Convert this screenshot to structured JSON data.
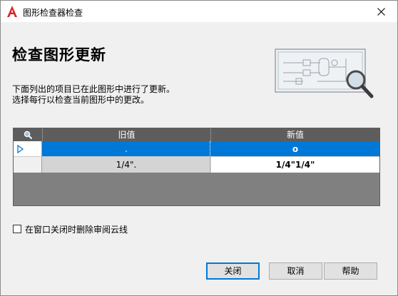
{
  "window": {
    "title": "图形检查器检查",
    "app_icon": "autocad-a-icon",
    "close_icon": "close-icon"
  },
  "heading": "检查图形更新",
  "description": {
    "line1": "下面列出的项目已在此图形中进行了更新。",
    "line2": "选择每行以检查当前图形中的更改。"
  },
  "grid": {
    "corner_icon": "magnifier-icon",
    "columns": [
      "旧值",
      "新值"
    ],
    "rows": [
      {
        "indicator": "triangle-right-icon",
        "old": ".",
        "new": "o",
        "selected": true
      },
      {
        "indicator": "",
        "old": "1/4\".",
        "new": "1/4\"1/4\"",
        "selected": false
      }
    ]
  },
  "checkbox": {
    "label": "在窗口关闭时删除审阅云线",
    "checked": false
  },
  "buttons": {
    "close": "关闭",
    "cancel": "取消",
    "help": "帮助"
  },
  "colors": {
    "selection": "#0078d7",
    "header_bg": "#5d5d5d",
    "grid_bg": "#808080",
    "brand_red": "#d8262c"
  }
}
